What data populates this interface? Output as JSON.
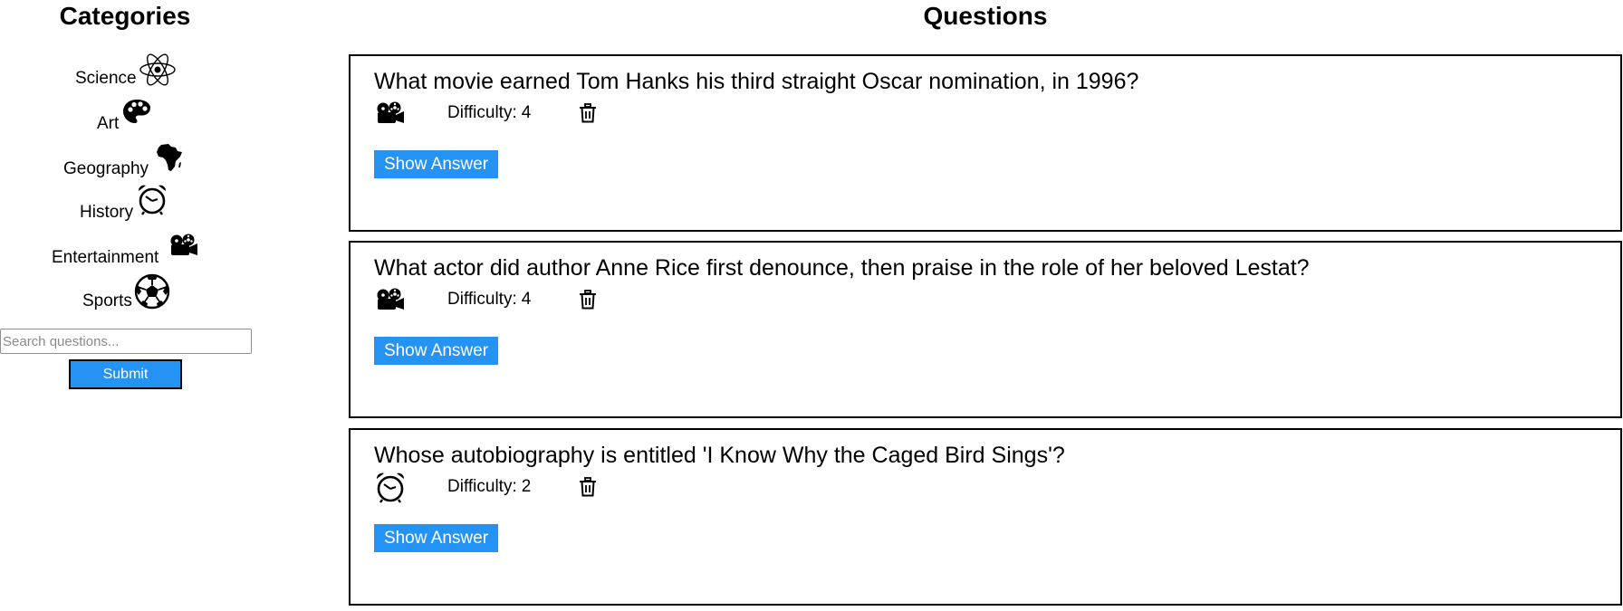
{
  "categories_panel": {
    "heading": "Categories",
    "items": [
      {
        "label": "Science",
        "icon": "atom-icon"
      },
      {
        "label": "Art",
        "icon": "palette-icon"
      },
      {
        "label": "Geography",
        "icon": "africa-map-icon"
      },
      {
        "label": "History",
        "icon": "alarm-clock-icon"
      },
      {
        "label": "Entertainment",
        "icon": "film-projector-icon"
      },
      {
        "label": "Sports",
        "icon": "soccer-ball-icon"
      }
    ],
    "search_placeholder": "Search questions...",
    "search_value": "",
    "submit_label": "Submit",
    "accent_color": "#2593f4"
  },
  "questions_panel": {
    "heading": "Questions",
    "questions": [
      {
        "text": "What movie earned Tom Hanks his third straight Oscar nomination, in 1996?",
        "category_icon": "film-projector-icon",
        "difficulty_label": "Difficulty:",
        "difficulty": "4",
        "delete_icon": "trash-icon",
        "show_answer_label": "Show Answer"
      },
      {
        "text": "What actor did author Anne Rice first denounce, then praise in the role of her beloved Lestat?",
        "category_icon": "film-projector-icon",
        "difficulty_label": "Difficulty:",
        "difficulty": "4",
        "delete_icon": "trash-icon",
        "show_answer_label": "Show Answer"
      },
      {
        "text": "Whose autobiography is entitled 'I Know Why the Caged Bird Sings'?",
        "category_icon": "alarm-clock-icon",
        "difficulty_label": "Difficulty:",
        "difficulty": "2",
        "delete_icon": "trash-icon",
        "show_answer_label": "Show Answer"
      }
    ]
  }
}
